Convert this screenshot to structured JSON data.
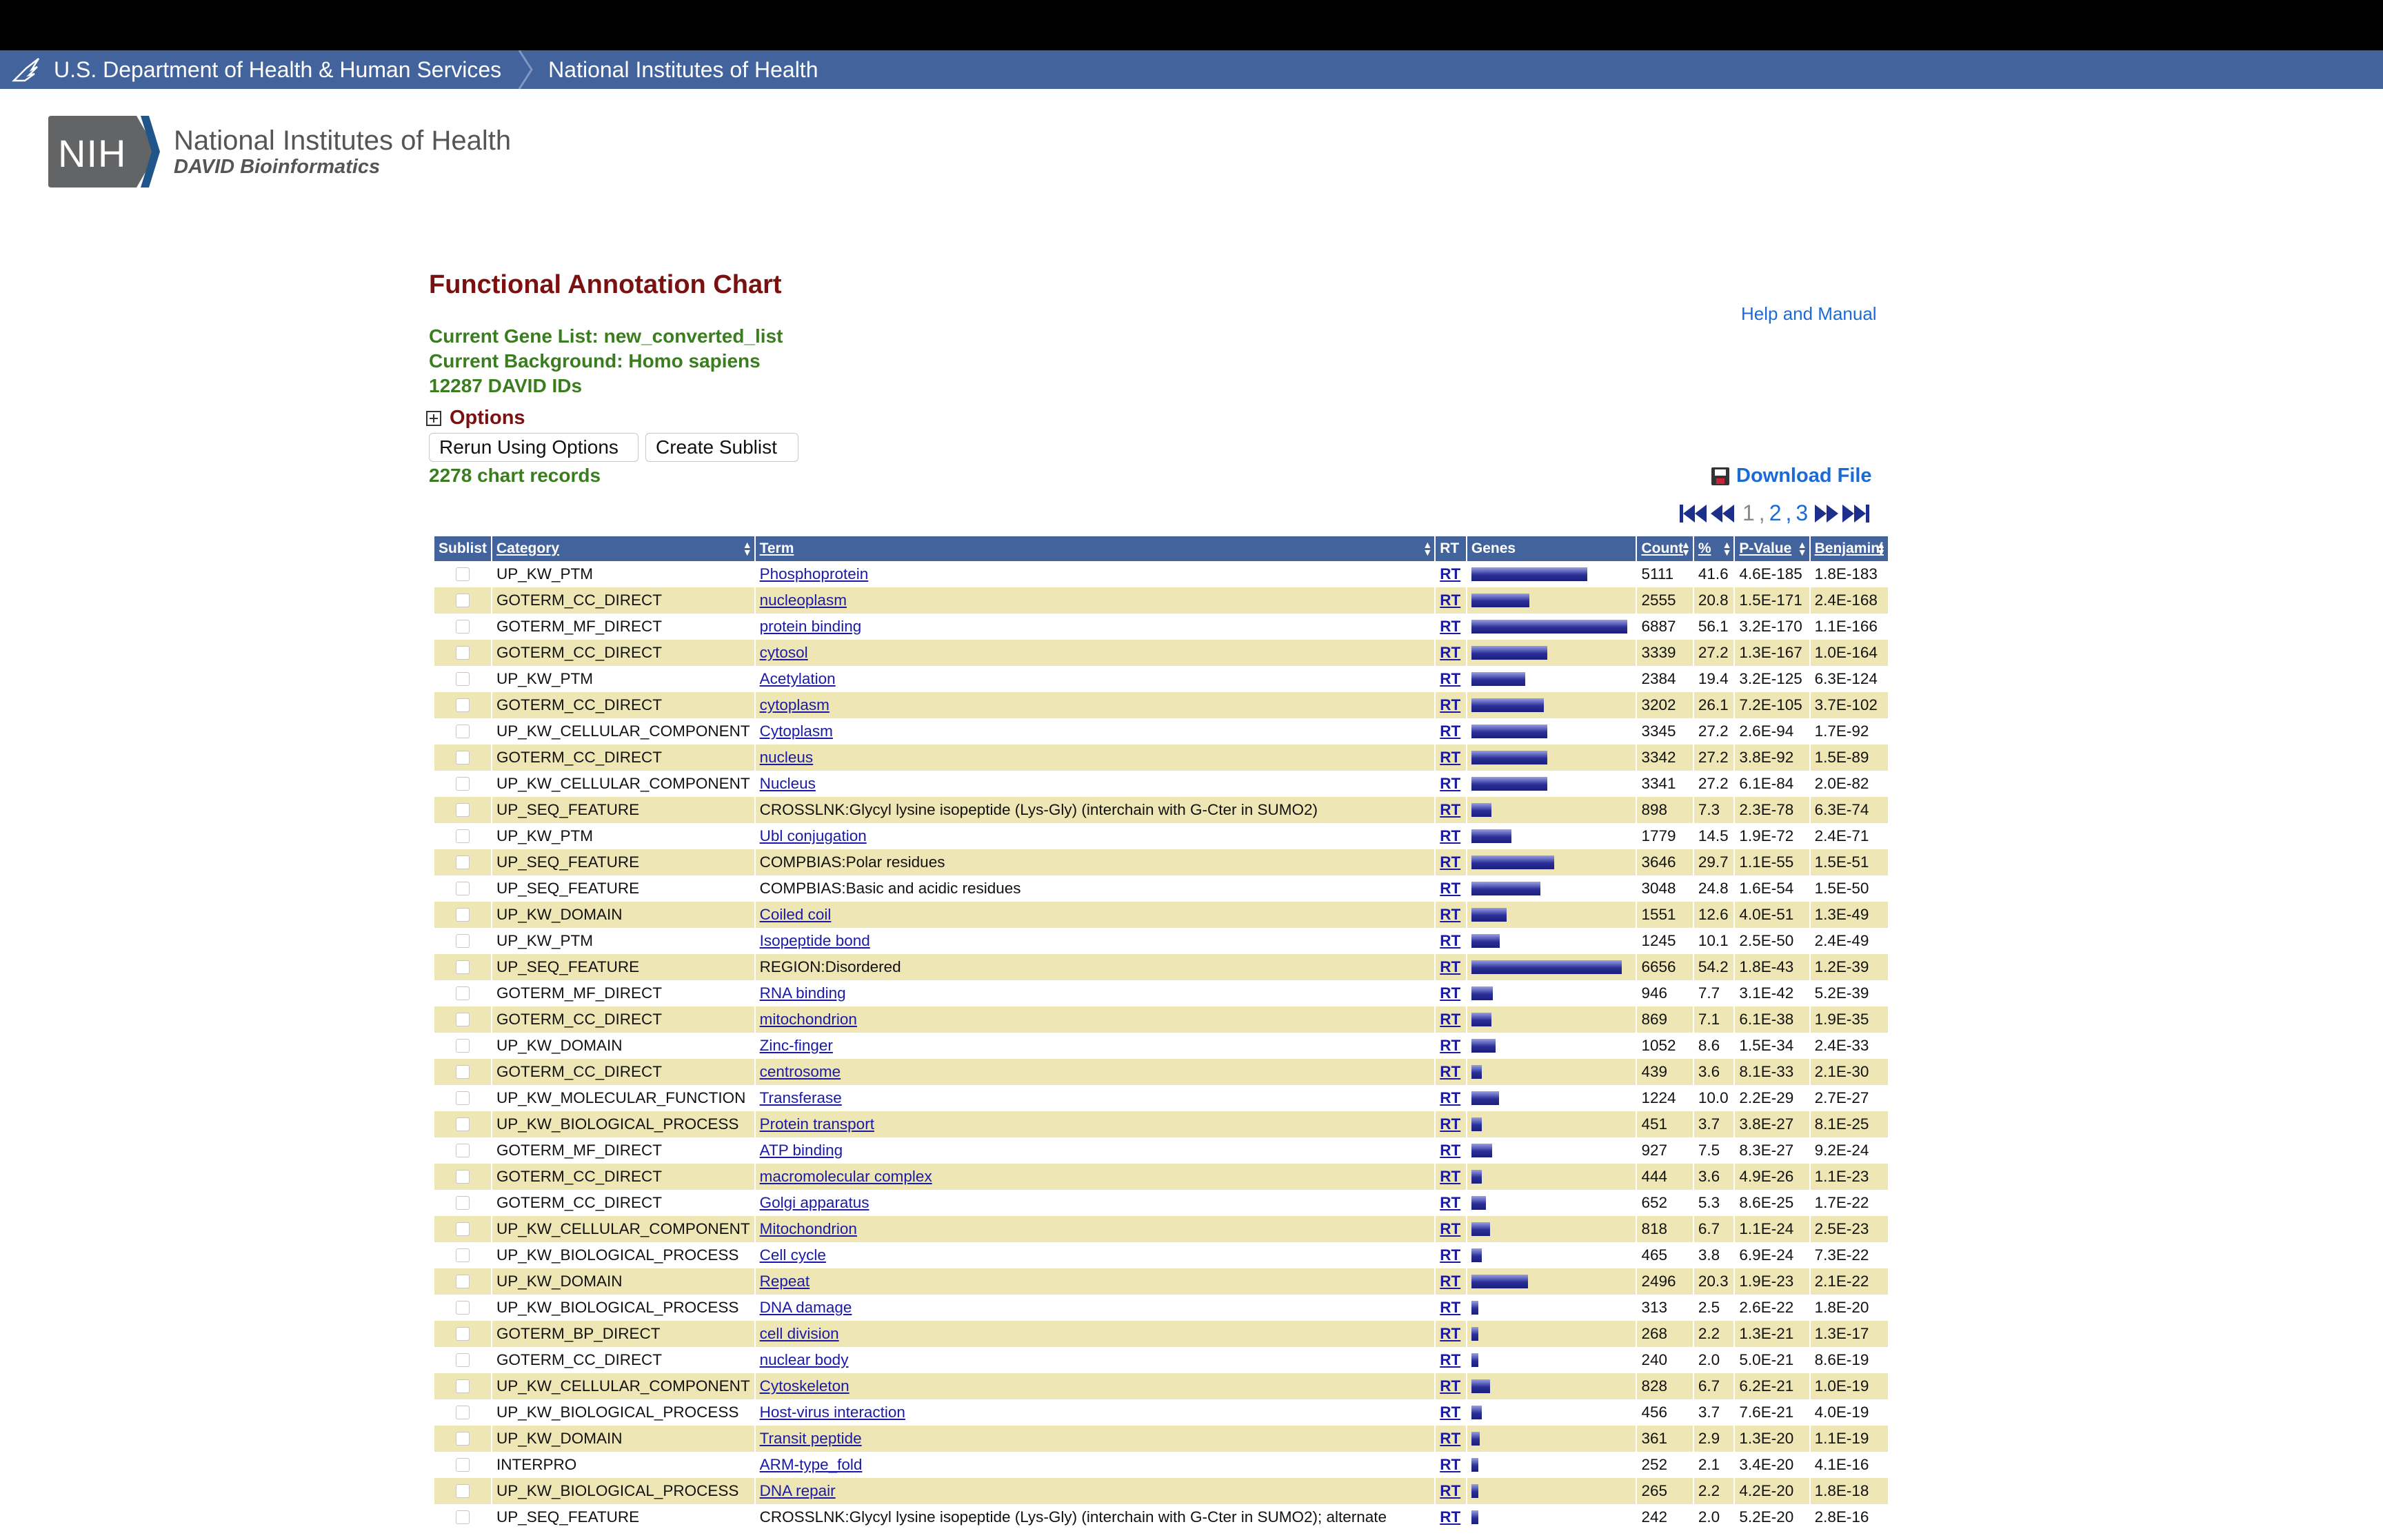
{
  "hhs_bar": {
    "agency": "U.S. Department of Health & Human Services",
    "institute": "National Institutes of Health"
  },
  "logo": {
    "mark": "NIH",
    "line1": "National Institutes of Health",
    "line2": "DAVID Bioinformatics"
  },
  "page": {
    "title": "Functional Annotation Chart",
    "help_link": "Help and Manual",
    "gene_list": "Current Gene List: new_converted_list",
    "background": "Current Background: Homo sapiens",
    "ids": "12287 DAVID IDs",
    "options_label": "Options",
    "rerun_button": "Rerun Using Options",
    "sublist_button": "Create Sublist",
    "records": "2278 chart records",
    "download_label": "Download File"
  },
  "pager": {
    "p1": "1",
    "sep1": ",",
    "p2": "2",
    "sep2": ",",
    "p3": "3"
  },
  "columns": {
    "sublist": "Sublist",
    "category": "Category",
    "term": "Term",
    "rt": "RT",
    "genes": "Genes",
    "count": "Count",
    "pct": "%",
    "pvalue": "P-Value",
    "benjamini": "Benjamini"
  },
  "rows": [
    {
      "category": "UP_KW_PTM",
      "term": "Phosphoprotein",
      "link": true,
      "rt": "RT",
      "count": "5111",
      "pct": "41.6",
      "p": "4.6E-185",
      "benj": "1.8E-183"
    },
    {
      "category": "GOTERM_CC_DIRECT",
      "term": "nucleoplasm",
      "link": true,
      "rt": "RT",
      "count": "2555",
      "pct": "20.8",
      "p": "1.5E-171",
      "benj": "2.4E-168"
    },
    {
      "category": "GOTERM_MF_DIRECT",
      "term": "protein binding",
      "link": true,
      "rt": "RT",
      "count": "6887",
      "pct": "56.1",
      "p": "3.2E-170",
      "benj": "1.1E-166"
    },
    {
      "category": "GOTERM_CC_DIRECT",
      "term": "cytosol",
      "link": true,
      "rt": "RT",
      "count": "3339",
      "pct": "27.2",
      "p": "1.3E-167",
      "benj": "1.0E-164"
    },
    {
      "category": "UP_KW_PTM",
      "term": "Acetylation",
      "link": true,
      "rt": "RT",
      "count": "2384",
      "pct": "19.4",
      "p": "3.2E-125",
      "benj": "6.3E-124"
    },
    {
      "category": "GOTERM_CC_DIRECT",
      "term": "cytoplasm",
      "link": true,
      "rt": "RT",
      "count": "3202",
      "pct": "26.1",
      "p": "7.2E-105",
      "benj": "3.7E-102"
    },
    {
      "category": "UP_KW_CELLULAR_COMPONENT",
      "term": "Cytoplasm",
      "link": true,
      "rt": "RT",
      "count": "3345",
      "pct": "27.2",
      "p": "2.6E-94",
      "benj": "1.7E-92"
    },
    {
      "category": "GOTERM_CC_DIRECT",
      "term": "nucleus",
      "link": true,
      "rt": "RT",
      "count": "3342",
      "pct": "27.2",
      "p": "3.8E-92",
      "benj": "1.5E-89"
    },
    {
      "category": "UP_KW_CELLULAR_COMPONENT",
      "term": "Nucleus",
      "link": true,
      "rt": "RT",
      "count": "3341",
      "pct": "27.2",
      "p": "6.1E-84",
      "benj": "2.0E-82"
    },
    {
      "category": "UP_SEQ_FEATURE",
      "term": "CROSSLNK:Glycyl lysine isopeptide (Lys-Gly) (interchain with G-Cter in SUMO2)",
      "link": false,
      "rt": "RT",
      "count": "898",
      "pct": "7.3",
      "p": "2.3E-78",
      "benj": "6.3E-74"
    },
    {
      "category": "UP_KW_PTM",
      "term": "Ubl conjugation",
      "link": true,
      "rt": "RT",
      "count": "1779",
      "pct": "14.5",
      "p": "1.9E-72",
      "benj": "2.4E-71"
    },
    {
      "category": "UP_SEQ_FEATURE",
      "term": "COMPBIAS:Polar residues",
      "link": false,
      "rt": "RT",
      "count": "3646",
      "pct": "29.7",
      "p": "1.1E-55",
      "benj": "1.5E-51"
    },
    {
      "category": "UP_SEQ_FEATURE",
      "term": "COMPBIAS:Basic and acidic residues",
      "link": false,
      "rt": "RT",
      "count": "3048",
      "pct": "24.8",
      "p": "1.6E-54",
      "benj": "1.5E-50"
    },
    {
      "category": "UP_KW_DOMAIN",
      "term": "Coiled coil",
      "link": true,
      "rt": "RT",
      "count": "1551",
      "pct": "12.6",
      "p": "4.0E-51",
      "benj": "1.3E-49"
    },
    {
      "category": "UP_KW_PTM",
      "term": "Isopeptide bond",
      "link": true,
      "rt": "RT",
      "count": "1245",
      "pct": "10.1",
      "p": "2.5E-50",
      "benj": "2.4E-49"
    },
    {
      "category": "UP_SEQ_FEATURE",
      "term": "REGION:Disordered",
      "link": false,
      "rt": "RT",
      "count": "6656",
      "pct": "54.2",
      "p": "1.8E-43",
      "benj": "1.2E-39"
    },
    {
      "category": "GOTERM_MF_DIRECT",
      "term": "RNA binding",
      "link": true,
      "rt": "RT",
      "count": "946",
      "pct": "7.7",
      "p": "3.1E-42",
      "benj": "5.2E-39"
    },
    {
      "category": "GOTERM_CC_DIRECT",
      "term": "mitochondrion",
      "link": true,
      "rt": "RT",
      "count": "869",
      "pct": "7.1",
      "p": "6.1E-38",
      "benj": "1.9E-35"
    },
    {
      "category": "UP_KW_DOMAIN",
      "term": "Zinc-finger",
      "link": true,
      "rt": "RT",
      "count": "1052",
      "pct": "8.6",
      "p": "1.5E-34",
      "benj": "2.4E-33"
    },
    {
      "category": "GOTERM_CC_DIRECT",
      "term": "centrosome",
      "link": true,
      "rt": "RT",
      "count": "439",
      "pct": "3.6",
      "p": "8.1E-33",
      "benj": "2.1E-30"
    },
    {
      "category": "UP_KW_MOLECULAR_FUNCTION",
      "term": "Transferase",
      "link": true,
      "rt": "RT",
      "count": "1224",
      "pct": "10.0",
      "p": "2.2E-29",
      "benj": "2.7E-27"
    },
    {
      "category": "UP_KW_BIOLOGICAL_PROCESS",
      "term": "Protein transport",
      "link": true,
      "rt": "RT",
      "count": "451",
      "pct": "3.7",
      "p": "3.8E-27",
      "benj": "8.1E-25"
    },
    {
      "category": "GOTERM_MF_DIRECT",
      "term": "ATP binding",
      "link": true,
      "rt": "RT",
      "count": "927",
      "pct": "7.5",
      "p": "8.3E-27",
      "benj": "9.2E-24"
    },
    {
      "category": "GOTERM_CC_DIRECT",
      "term": "macromolecular complex",
      "link": true,
      "rt": "RT",
      "count": "444",
      "pct": "3.6",
      "p": "4.9E-26",
      "benj": "1.1E-23"
    },
    {
      "category": "GOTERM_CC_DIRECT",
      "term": "Golgi apparatus",
      "link": true,
      "rt": "RT",
      "count": "652",
      "pct": "5.3",
      "p": "8.6E-25",
      "benj": "1.7E-22"
    },
    {
      "category": "UP_KW_CELLULAR_COMPONENT",
      "term": "Mitochondrion",
      "link": true,
      "rt": "RT",
      "count": "818",
      "pct": "6.7",
      "p": "1.1E-24",
      "benj": "2.5E-23"
    },
    {
      "category": "UP_KW_BIOLOGICAL_PROCESS",
      "term": "Cell cycle",
      "link": true,
      "rt": "RT",
      "count": "465",
      "pct": "3.8",
      "p": "6.9E-24",
      "benj": "7.3E-22"
    },
    {
      "category": "UP_KW_DOMAIN",
      "term": "Repeat",
      "link": true,
      "rt": "RT",
      "count": "2496",
      "pct": "20.3",
      "p": "1.9E-23",
      "benj": "2.1E-22"
    },
    {
      "category": "UP_KW_BIOLOGICAL_PROCESS",
      "term": "DNA damage",
      "link": true,
      "rt": "RT",
      "count": "313",
      "pct": "2.5",
      "p": "2.6E-22",
      "benj": "1.8E-20"
    },
    {
      "category": "GOTERM_BP_DIRECT",
      "term": "cell division",
      "link": true,
      "rt": "RT",
      "count": "268",
      "pct": "2.2",
      "p": "1.3E-21",
      "benj": "1.3E-17"
    },
    {
      "category": "GOTERM_CC_DIRECT",
      "term": "nuclear body",
      "link": true,
      "rt": "RT",
      "count": "240",
      "pct": "2.0",
      "p": "5.0E-21",
      "benj": "8.6E-19"
    },
    {
      "category": "UP_KW_CELLULAR_COMPONENT",
      "term": "Cytoskeleton",
      "link": true,
      "rt": "RT",
      "count": "828",
      "pct": "6.7",
      "p": "6.2E-21",
      "benj": "1.0E-19"
    },
    {
      "category": "UP_KW_BIOLOGICAL_PROCESS",
      "term": "Host-virus interaction",
      "link": true,
      "rt": "RT",
      "count": "456",
      "pct": "3.7",
      "p": "7.6E-21",
      "benj": "4.0E-19"
    },
    {
      "category": "UP_KW_DOMAIN",
      "term": "Transit peptide",
      "link": true,
      "rt": "RT",
      "count": "361",
      "pct": "2.9",
      "p": "1.3E-20",
      "benj": "1.1E-19"
    },
    {
      "category": "INTERPRO",
      "term": "ARM-type_fold",
      "link": true,
      "rt": "RT",
      "count": "252",
      "pct": "2.1",
      "p": "3.4E-20",
      "benj": "4.1E-16"
    },
    {
      "category": "UP_KW_BIOLOGICAL_PROCESS",
      "term": "DNA repair",
      "link": true,
      "rt": "RT",
      "count": "265",
      "pct": "2.2",
      "p": "4.2E-20",
      "benj": "1.8E-18"
    },
    {
      "category": "UP_SEQ_FEATURE",
      "term": "CROSSLNK:Glycyl lysine isopeptide (Lys-Gly) (interchain with G-Cter in SUMO2); alternate",
      "link": false,
      "rt": "RT",
      "count": "242",
      "pct": "2.0",
      "p": "5.2E-20",
      "benj": "2.8E-16"
    }
  ]
}
